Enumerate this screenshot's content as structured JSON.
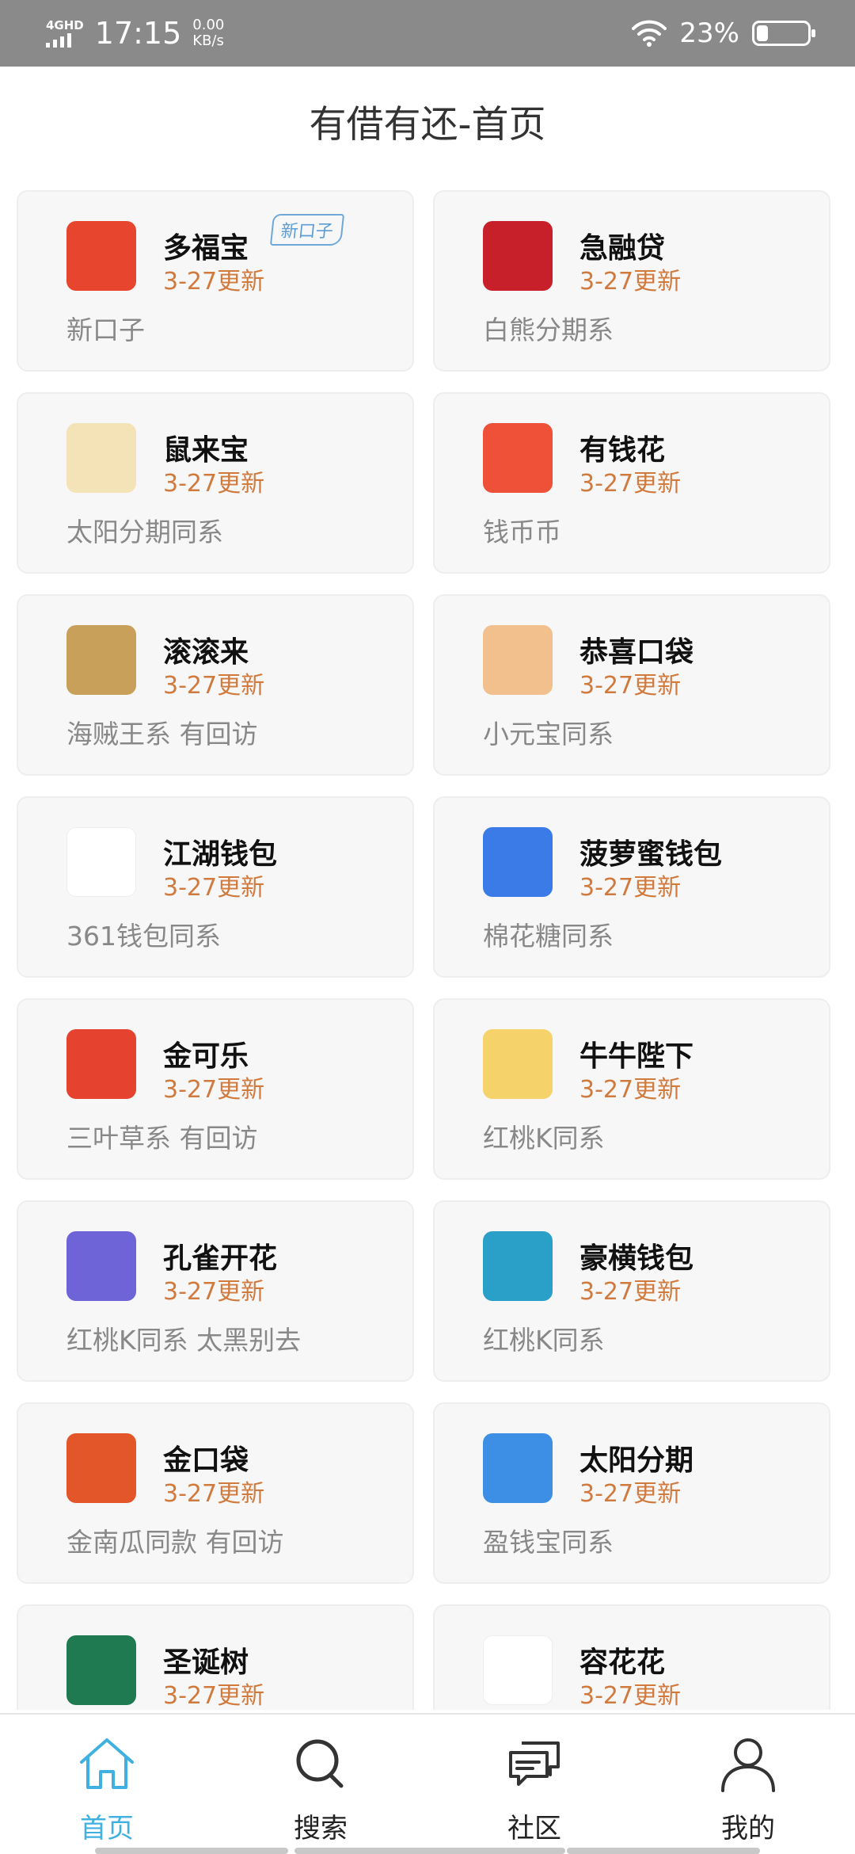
{
  "status_bar": {
    "network": "4GHD",
    "time": "17:15",
    "speed_value": "0.00",
    "speed_unit": "KB/s",
    "battery_pct": "23%",
    "battery_level": 0.23
  },
  "page_title": "有借有还-首页",
  "apps": [
    {
      "name": "多福宝",
      "date": "3-27更新",
      "desc": "新口子",
      "badge": "新口子",
      "icon": "cartoon-fortune-god-icon",
      "color": "#e8452f"
    },
    {
      "name": "急融贷",
      "date": "3-27更新",
      "desc": "白熊分期系",
      "badge": "",
      "icon": "red-j-logo-icon",
      "color": "#c8202a"
    },
    {
      "name": "鼠来宝",
      "date": "3-27更新",
      "desc": "太阳分期同系",
      "badge": "",
      "icon": "mouse-gold-icon",
      "color": "#f5e3b8"
    },
    {
      "name": "有钱花",
      "date": "3-27更新",
      "desc": "钱币币",
      "badge": "",
      "icon": "red-envelope-icon",
      "color": "#ef5138"
    },
    {
      "name": "滚滚来",
      "date": "3-27更新",
      "desc": "海贼王系 有回访",
      "badge": "",
      "icon": "gold-coin-loop-icon",
      "color": "#c9a05a"
    },
    {
      "name": "恭喜口袋",
      "date": "3-27更新",
      "desc": "小元宝同系",
      "badge": "",
      "icon": "red-money-bag-icon",
      "color": "#f2c08c"
    },
    {
      "name": "江湖钱包",
      "date": "3-27更新",
      "desc": "361钱包同系",
      "badge": "",
      "icon": "gold-wallet-icon",
      "color": "#ffffff"
    },
    {
      "name": "菠萝蜜钱包",
      "date": "3-27更新",
      "desc": "棉花糖同系",
      "badge": "",
      "icon": "jackfruit-cartoon-icon",
      "color": "#3a7be8"
    },
    {
      "name": "金可乐",
      "date": "3-27更新",
      "desc": "三叶草系 有回访",
      "badge": "",
      "icon": "cola-cup-icon",
      "color": "#e5432f"
    },
    {
      "name": "牛牛陛下",
      "date": "3-27更新",
      "desc": "红桃K同系",
      "badge": "",
      "icon": "bull-king-icon",
      "color": "#f6d26a"
    },
    {
      "name": "孔雀开花",
      "date": "3-27更新",
      "desc": "红桃K同系 太黑别去",
      "badge": "",
      "icon": "peacock-icon",
      "color": "#6f63d8"
    },
    {
      "name": "豪横钱包",
      "date": "3-27更新",
      "desc": "红桃K同系",
      "badge": "",
      "icon": "rich-man-cartoon-icon",
      "color": "#2aa0c8"
    },
    {
      "name": "金口袋",
      "date": "3-27更新",
      "desc": "金南瓜同款 有回访",
      "badge": "",
      "icon": "orange-shield-icon",
      "color": "#e2562a"
    },
    {
      "name": "太阳分期",
      "date": "3-27更新",
      "desc": "盈钱宝同系",
      "badge": "",
      "icon": "sun-wave-icon",
      "color": "#3d8fe6"
    },
    {
      "name": "圣诞树",
      "date": "3-27更新",
      "desc": "",
      "badge": "",
      "icon": "christmas-tree-icon",
      "color": "#1f7a52"
    },
    {
      "name": "容花花",
      "date": "3-27更新",
      "desc": "",
      "badge": "",
      "icon": "pink-rose-icon",
      "color": "#ffffff"
    }
  ],
  "tabs": [
    {
      "label": "首页",
      "icon": "home-icon",
      "active": true
    },
    {
      "label": "搜索",
      "icon": "search-icon",
      "active": false
    },
    {
      "label": "社区",
      "icon": "chat-bubbles-icon",
      "active": false
    },
    {
      "label": "我的",
      "icon": "user-icon",
      "active": false
    }
  ],
  "colors": {
    "accent": "#3fb0e0",
    "date": "#d07a3e",
    "status_bar": "#8a8a8a"
  }
}
